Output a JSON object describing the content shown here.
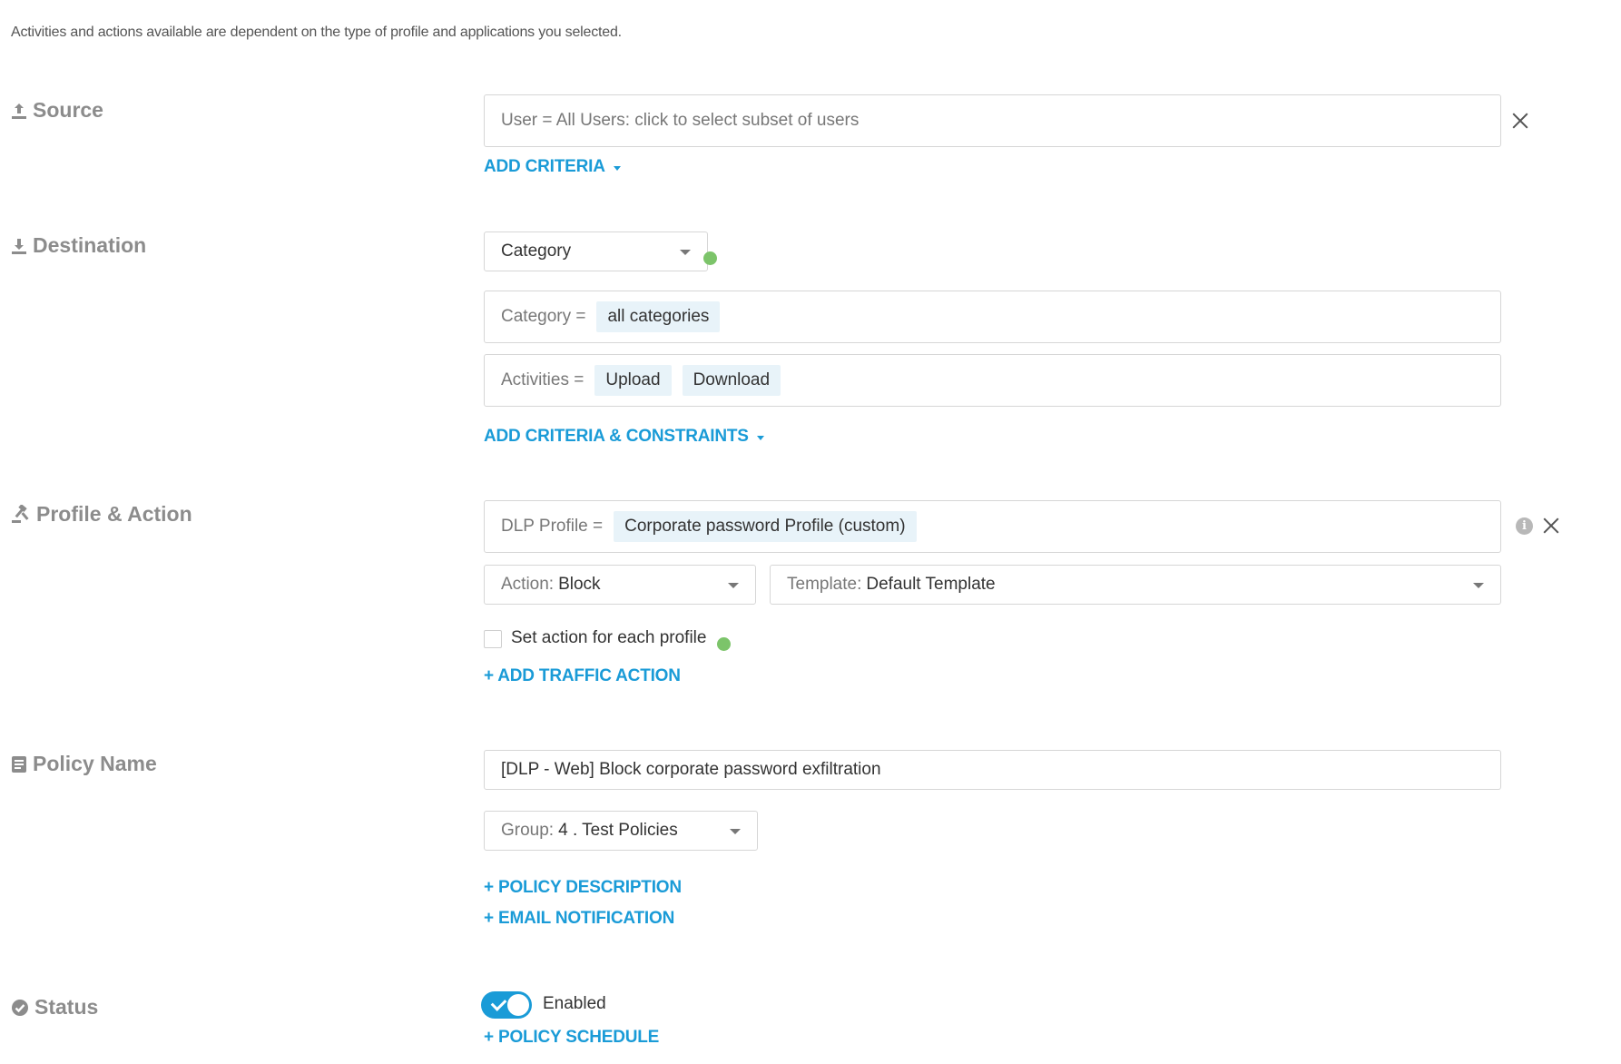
{
  "intro_text": "Activities and actions available are dependent on the type of profile and applications you selected.",
  "source": {
    "label": "Source",
    "user_field": "User = All Users: click to select subset of users",
    "add_criteria": "ADD CRITERIA"
  },
  "destination": {
    "label": "Destination",
    "type_select": "Category",
    "category_prefix": "Category =",
    "category_value": "all categories",
    "activities_prefix": "Activities =",
    "activities": [
      "Upload",
      "Download"
    ],
    "add_criteria_constraints": "ADD CRITERIA & CONSTRAINTS"
  },
  "profile_action": {
    "label": "Profile & Action",
    "dlp_prefix": "DLP Profile =",
    "dlp_value": "Corporate password Profile (custom)",
    "action_prefix": "Action:",
    "action_value": "Block",
    "template_prefix": "Template:",
    "template_value": "Default Template",
    "set_action_checkbox": "Set action for each profile",
    "add_traffic_action": "+ ADD TRAFFIC ACTION"
  },
  "policy_name": {
    "label": "Policy Name",
    "name_value": "[DLP - Web] Block corporate password exfiltration",
    "group_prefix": "Group:",
    "group_value": "4 . Test Policies",
    "policy_description": "+ POLICY DESCRIPTION",
    "email_notification": "+ EMAIL NOTIFICATION"
  },
  "status": {
    "label": "Status",
    "toggle_label": "Enabled",
    "toggle_on": true,
    "policy_schedule": "+ POLICY SCHEDULE"
  },
  "colors": {
    "accent": "#1a9bd7",
    "chip_bg": "#e8f3f9",
    "status_dot": "#7cc46a",
    "section_label": "#8c8c8c"
  }
}
